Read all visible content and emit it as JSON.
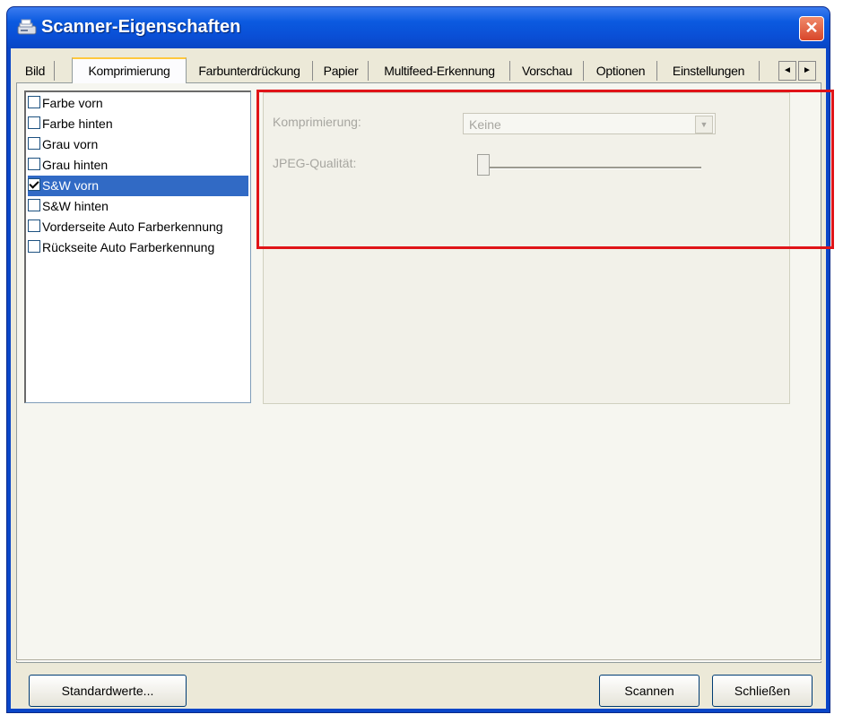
{
  "window": {
    "title": "Scanner-Eigenschaften",
    "close_label": "✕"
  },
  "tabs": [
    {
      "label": "Bild"
    },
    {
      "label": "Komprimierung",
      "active": true
    },
    {
      "label": "Farbunterdrückung"
    },
    {
      "label": "Papier"
    },
    {
      "label": "Multifeed-Erkennung"
    },
    {
      "label": "Vorschau"
    },
    {
      "label": "Optionen"
    },
    {
      "label": "Einstellungen"
    }
  ],
  "tab_scroll": {
    "left": "◄",
    "right": "►"
  },
  "image_list": [
    {
      "label": "Farbe vorn",
      "checked": false,
      "selected": false
    },
    {
      "label": "Farbe hinten",
      "checked": false,
      "selected": false
    },
    {
      "label": "Grau vorn",
      "checked": false,
      "selected": false
    },
    {
      "label": "Grau hinten",
      "checked": false,
      "selected": false
    },
    {
      "label": "S&W vorn",
      "checked": true,
      "selected": true
    },
    {
      "label": "S&W hinten",
      "checked": false,
      "selected": false
    },
    {
      "label": "Vorderseite Auto Farberkennung",
      "checked": false,
      "selected": false
    },
    {
      "label": "Rückseite Auto Farberkennung",
      "checked": false,
      "selected": false
    }
  ],
  "compression": {
    "label": "Komprimierung:",
    "value": "Keine",
    "enabled": false
  },
  "jpeg_quality": {
    "label": "JPEG-Qualität:",
    "level": 0,
    "enabled": false
  },
  "buttons": {
    "defaults": "Standardwerte...",
    "scan": "Scannen",
    "close": "Schließen"
  },
  "colors": {
    "highlight": "#e01418",
    "selection": "#316ac5",
    "titlebar": "#0a4fd6"
  }
}
